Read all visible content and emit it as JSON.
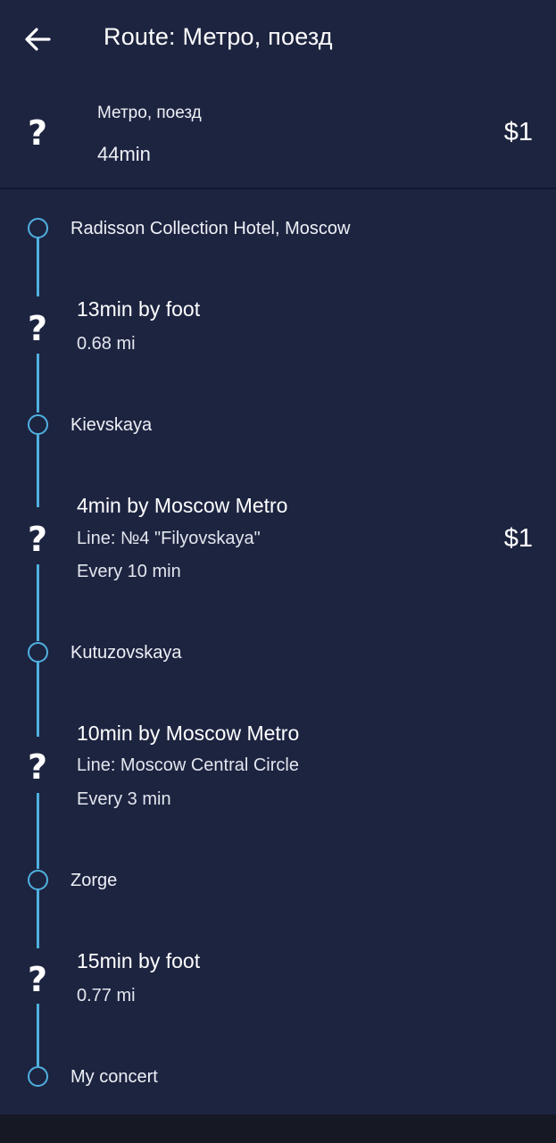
{
  "header": {
    "title": "Route: Метро, поезд",
    "back_icon": "arrow-left-icon"
  },
  "summary": {
    "mode": "Метро, поезд",
    "duration": "44min",
    "price": "$1",
    "icon": "question-icon"
  },
  "stops": [
    {
      "name": "Radisson Collection Hotel, Moscow"
    },
    {
      "name": "Kievskaya"
    },
    {
      "name": "Kutuzovskaya"
    },
    {
      "name": "Zorge"
    },
    {
      "name": "My concert"
    }
  ],
  "segments": [
    {
      "title": "13min by foot",
      "distance": "0.68 mi",
      "icon": "question-icon"
    },
    {
      "title": "4min by Moscow Metro",
      "line": "Line: №4 \"Filyovskaya\"",
      "frequency": "Every 10 min",
      "price": "$1",
      "icon": "question-icon"
    },
    {
      "title": "10min by Moscow Metro",
      "line": "Line: Moscow Central Circle",
      "frequency": "Every 3 min",
      "icon": "question-icon"
    },
    {
      "title": "15min by foot",
      "distance": "0.77 mi",
      "icon": "question-icon"
    }
  ],
  "colors": {
    "background": "#1d2440",
    "accent": "#4fb0e0",
    "divider": "#131831"
  }
}
